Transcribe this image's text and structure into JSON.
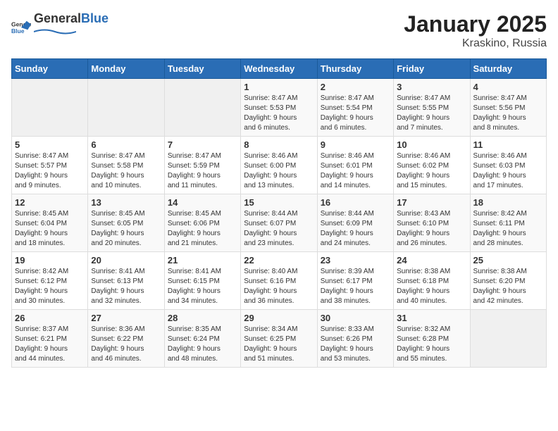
{
  "logo": {
    "general": "General",
    "blue": "Blue"
  },
  "title": "January 2025",
  "subtitle": "Kraskino, Russia",
  "days_of_week": [
    "Sunday",
    "Monday",
    "Tuesday",
    "Wednesday",
    "Thursday",
    "Friday",
    "Saturday"
  ],
  "weeks": [
    [
      {
        "day": "",
        "info": ""
      },
      {
        "day": "",
        "info": ""
      },
      {
        "day": "",
        "info": ""
      },
      {
        "day": "1",
        "info": "Sunrise: 8:47 AM\nSunset: 5:53 PM\nDaylight: 9 hours\nand 6 minutes."
      },
      {
        "day": "2",
        "info": "Sunrise: 8:47 AM\nSunset: 5:54 PM\nDaylight: 9 hours\nand 6 minutes."
      },
      {
        "day": "3",
        "info": "Sunrise: 8:47 AM\nSunset: 5:55 PM\nDaylight: 9 hours\nand 7 minutes."
      },
      {
        "day": "4",
        "info": "Sunrise: 8:47 AM\nSunset: 5:56 PM\nDaylight: 9 hours\nand 8 minutes."
      }
    ],
    [
      {
        "day": "5",
        "info": "Sunrise: 8:47 AM\nSunset: 5:57 PM\nDaylight: 9 hours\nand 9 minutes."
      },
      {
        "day": "6",
        "info": "Sunrise: 8:47 AM\nSunset: 5:58 PM\nDaylight: 9 hours\nand 10 minutes."
      },
      {
        "day": "7",
        "info": "Sunrise: 8:47 AM\nSunset: 5:59 PM\nDaylight: 9 hours\nand 11 minutes."
      },
      {
        "day": "8",
        "info": "Sunrise: 8:46 AM\nSunset: 6:00 PM\nDaylight: 9 hours\nand 13 minutes."
      },
      {
        "day": "9",
        "info": "Sunrise: 8:46 AM\nSunset: 6:01 PM\nDaylight: 9 hours\nand 14 minutes."
      },
      {
        "day": "10",
        "info": "Sunrise: 8:46 AM\nSunset: 6:02 PM\nDaylight: 9 hours\nand 15 minutes."
      },
      {
        "day": "11",
        "info": "Sunrise: 8:46 AM\nSunset: 6:03 PM\nDaylight: 9 hours\nand 17 minutes."
      }
    ],
    [
      {
        "day": "12",
        "info": "Sunrise: 8:45 AM\nSunset: 6:04 PM\nDaylight: 9 hours\nand 18 minutes."
      },
      {
        "day": "13",
        "info": "Sunrise: 8:45 AM\nSunset: 6:05 PM\nDaylight: 9 hours\nand 20 minutes."
      },
      {
        "day": "14",
        "info": "Sunrise: 8:45 AM\nSunset: 6:06 PM\nDaylight: 9 hours\nand 21 minutes."
      },
      {
        "day": "15",
        "info": "Sunrise: 8:44 AM\nSunset: 6:07 PM\nDaylight: 9 hours\nand 23 minutes."
      },
      {
        "day": "16",
        "info": "Sunrise: 8:44 AM\nSunset: 6:09 PM\nDaylight: 9 hours\nand 24 minutes."
      },
      {
        "day": "17",
        "info": "Sunrise: 8:43 AM\nSunset: 6:10 PM\nDaylight: 9 hours\nand 26 minutes."
      },
      {
        "day": "18",
        "info": "Sunrise: 8:42 AM\nSunset: 6:11 PM\nDaylight: 9 hours\nand 28 minutes."
      }
    ],
    [
      {
        "day": "19",
        "info": "Sunrise: 8:42 AM\nSunset: 6:12 PM\nDaylight: 9 hours\nand 30 minutes."
      },
      {
        "day": "20",
        "info": "Sunrise: 8:41 AM\nSunset: 6:13 PM\nDaylight: 9 hours\nand 32 minutes."
      },
      {
        "day": "21",
        "info": "Sunrise: 8:41 AM\nSunset: 6:15 PM\nDaylight: 9 hours\nand 34 minutes."
      },
      {
        "day": "22",
        "info": "Sunrise: 8:40 AM\nSunset: 6:16 PM\nDaylight: 9 hours\nand 36 minutes."
      },
      {
        "day": "23",
        "info": "Sunrise: 8:39 AM\nSunset: 6:17 PM\nDaylight: 9 hours\nand 38 minutes."
      },
      {
        "day": "24",
        "info": "Sunrise: 8:38 AM\nSunset: 6:18 PM\nDaylight: 9 hours\nand 40 minutes."
      },
      {
        "day": "25",
        "info": "Sunrise: 8:38 AM\nSunset: 6:20 PM\nDaylight: 9 hours\nand 42 minutes."
      }
    ],
    [
      {
        "day": "26",
        "info": "Sunrise: 8:37 AM\nSunset: 6:21 PM\nDaylight: 9 hours\nand 44 minutes."
      },
      {
        "day": "27",
        "info": "Sunrise: 8:36 AM\nSunset: 6:22 PM\nDaylight: 9 hours\nand 46 minutes."
      },
      {
        "day": "28",
        "info": "Sunrise: 8:35 AM\nSunset: 6:24 PM\nDaylight: 9 hours\nand 48 minutes."
      },
      {
        "day": "29",
        "info": "Sunrise: 8:34 AM\nSunset: 6:25 PM\nDaylight: 9 hours\nand 51 minutes."
      },
      {
        "day": "30",
        "info": "Sunrise: 8:33 AM\nSunset: 6:26 PM\nDaylight: 9 hours\nand 53 minutes."
      },
      {
        "day": "31",
        "info": "Sunrise: 8:32 AM\nSunset: 6:28 PM\nDaylight: 9 hours\nand 55 minutes."
      },
      {
        "day": "",
        "info": ""
      }
    ]
  ]
}
